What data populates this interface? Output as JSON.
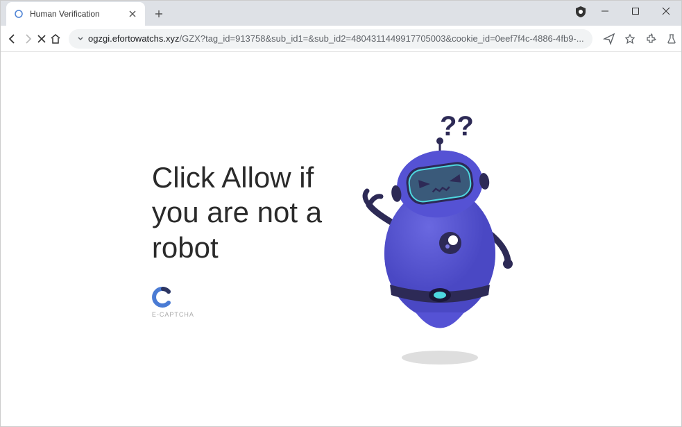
{
  "window": {
    "tab_title": "Human Verification"
  },
  "toolbar": {
    "url_domain": "ogzgi.efortowatchs.xyz",
    "url_path": "/GZX?tag_id=913758&sub_id1=&sub_id2=4804311449917705003&cookie_id=0eef7f4c-4886-4fb9-..."
  },
  "content": {
    "headline_line1": "Click Allow if",
    "headline_line2": "you are not a",
    "headline_line3": "robot",
    "captcha_label": "E-CAPTCHA",
    "question_marks": "??"
  }
}
